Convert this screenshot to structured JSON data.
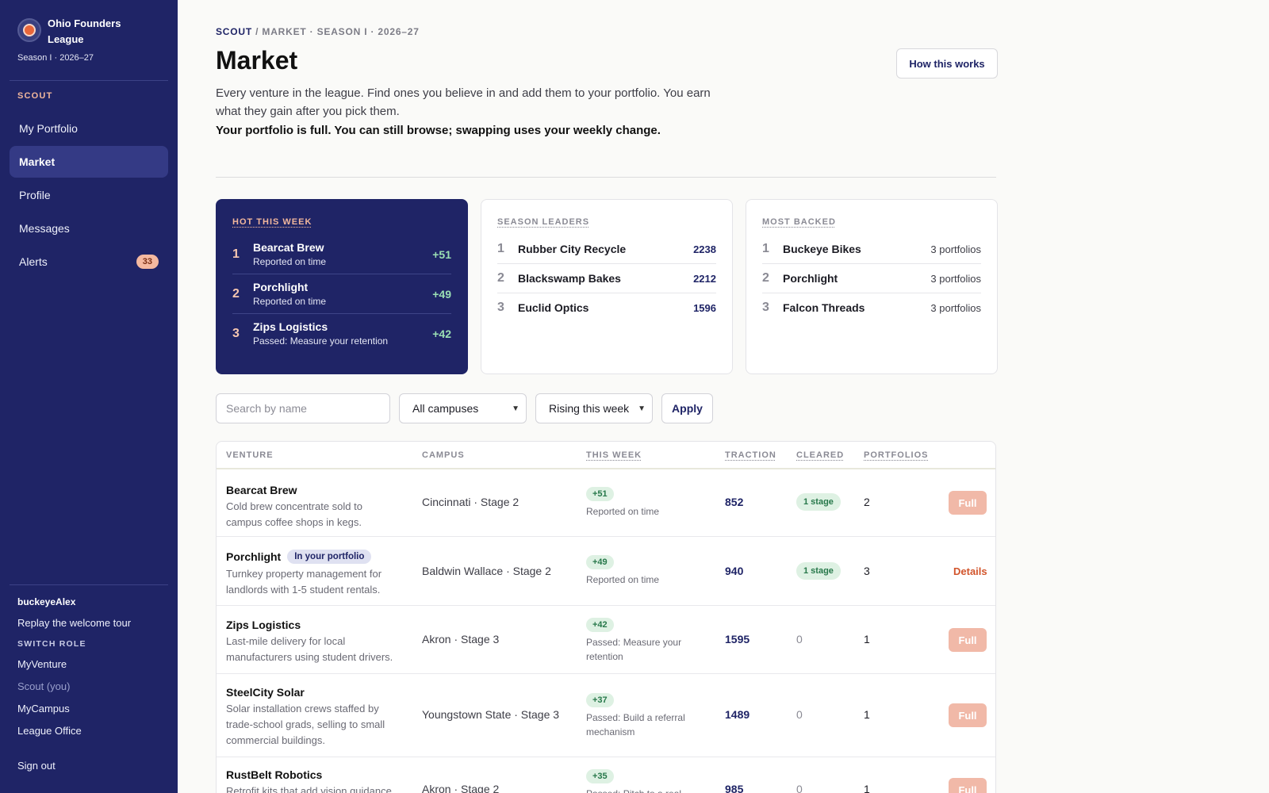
{
  "sidebar": {
    "league_name": "Ohio Founders League",
    "season": "Season I · 2026–27",
    "section_label": "SCOUT",
    "items": [
      {
        "label": "My Portfolio"
      },
      {
        "label": "Market"
      },
      {
        "label": "Profile"
      },
      {
        "label": "Messages"
      },
      {
        "label": "Alerts",
        "badge": "33"
      }
    ],
    "username": "buckeyeAlex",
    "replay_tour": "Replay the welcome tour",
    "switch_role_label": "SWITCH ROLE",
    "roles": [
      "MyVenture",
      "Scout (you)",
      "MyCampus",
      "League Office"
    ],
    "sign_out": "Sign out"
  },
  "header": {
    "breadcrumb_root": "SCOUT",
    "breadcrumb_rest": " / MARKET · SEASON I · 2026–27",
    "title": "Market",
    "how_button": "How this works",
    "intro": "Every venture in the league. Find ones you believe in and add them to your portfolio. You earn what they gain after you pick them.",
    "full_note": "Your portfolio is full. You can still browse; swapping uses your weekly change."
  },
  "hot": {
    "title": "HOT THIS WEEK",
    "rows": [
      {
        "rank": "1",
        "name": "Bearcat Brew",
        "sub": "Reported on time",
        "delta": "+51"
      },
      {
        "rank": "2",
        "name": "Porchlight",
        "sub": "Reported on time",
        "delta": "+49"
      },
      {
        "rank": "3",
        "name": "Zips Logistics",
        "sub": "Passed: Measure your retention",
        "delta": "+42"
      }
    ]
  },
  "leaders": {
    "title": "SEASON LEADERS",
    "rows": [
      {
        "rank": "1",
        "name": "Rubber City Recycle",
        "value": "2238"
      },
      {
        "rank": "2",
        "name": "Blackswamp Bakes",
        "value": "2212"
      },
      {
        "rank": "3",
        "name": "Euclid Optics",
        "value": "1596"
      }
    ]
  },
  "backed": {
    "title": "MOST BACKED",
    "rows": [
      {
        "rank": "1",
        "name": "Buckeye Bikes",
        "value": "3 portfolios"
      },
      {
        "rank": "2",
        "name": "Porchlight",
        "value": "3 portfolios"
      },
      {
        "rank": "3",
        "name": "Falcon Threads",
        "value": "3 portfolios"
      }
    ]
  },
  "filters": {
    "search_placeholder": "Search by name",
    "campus": "All campuses",
    "sort": "Rising this week",
    "apply": "Apply"
  },
  "table": {
    "headers": {
      "venture": "VENTURE",
      "campus": "CAMPUS",
      "week": "THIS WEEK",
      "traction": "TRACTION",
      "cleared": "CLEARED",
      "portfolios": "PORTFOLIOS"
    },
    "rows": [
      {
        "name": "Bearcat Brew",
        "desc": "Cold brew concentrate sold to campus coffee shops in kegs.",
        "campus": "Cincinnati · Stage 2",
        "delta": "+51",
        "week_sub": "Reported on time",
        "traction": "852",
        "cleared": "1 stage",
        "portfolios": "2",
        "action": "Full"
      },
      {
        "name": "Porchlight",
        "tag": "In your portfolio",
        "desc": "Turnkey property management for landlords with 1-5 student rentals.",
        "campus": "Baldwin Wallace · Stage 2",
        "delta": "+49",
        "week_sub": "Reported on time",
        "traction": "940",
        "cleared": "1 stage",
        "portfolios": "3",
        "action": "Details"
      },
      {
        "name": "Zips Logistics",
        "desc": "Last-mile delivery for local manufacturers using student drivers.",
        "campus": "Akron · Stage 3",
        "delta": "+42",
        "week_sub": "Passed: Measure your retention",
        "traction": "1595",
        "cleared": "0",
        "portfolios": "1",
        "action": "Full"
      },
      {
        "name": "SteelCity Solar",
        "desc": "Solar installation crews staffed by trade-school grads, selling to small commercial buildings.",
        "campus": "Youngstown State · Stage 3",
        "delta": "+37",
        "week_sub": "Passed: Build a referral mechanism",
        "traction": "1489",
        "cleared": "0",
        "portfolios": "1",
        "action": "Full"
      },
      {
        "name": "RustBelt Robotics",
        "desc": "Retrofit kits that add vision guidance",
        "campus": "Akron · Stage 2",
        "delta": "+35",
        "week_sub": "Passed: Pitch to a real",
        "traction": "985",
        "cleared": "0",
        "portfolios": "1",
        "action": "Full"
      }
    ]
  }
}
